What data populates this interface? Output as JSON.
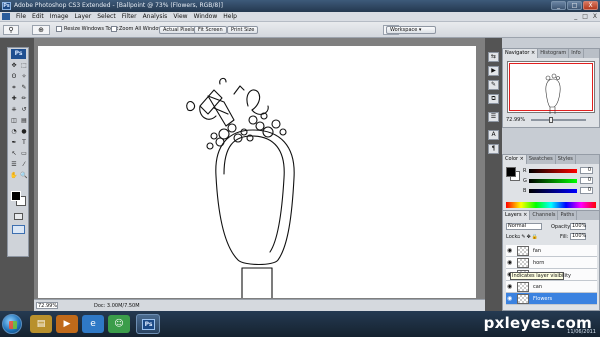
{
  "window": {
    "title": "Adobe Photoshop CS3 Extended - [Ballpoint @ 73% (Flowers, RGB/8)]",
    "app_icon_text": "Ps",
    "buttons": {
      "minimize": "_",
      "maximize": "□",
      "close": "X"
    }
  },
  "menubar": {
    "items": [
      "File",
      "Edit",
      "Image",
      "Layer",
      "Select",
      "Filter",
      "Analysis",
      "View",
      "Window",
      "Help"
    ],
    "doc_controls": [
      "_",
      "□",
      "X"
    ]
  },
  "options": {
    "resize_windows": "Resize Windows To Fit",
    "zoom_all": "Zoom All Windows",
    "actual_pixels": "Actual Pixels",
    "fit_screen": "Fit Screen",
    "print_size": "Print Size",
    "workspace": "Workspace ▾"
  },
  "tools": {
    "ps_label": "Ps",
    "icons": [
      "move-icon",
      "marquee-icon",
      "lasso-icon",
      "magic-wand-icon",
      "crop-icon",
      "slice-icon",
      "healing-icon",
      "brush-icon",
      "stamp-icon",
      "history-brush-icon",
      "eraser-icon",
      "gradient-icon",
      "blur-icon",
      "dodge-icon",
      "pen-icon",
      "type-icon",
      "path-select-icon",
      "shape-icon",
      "notes-icon",
      "eyedropper-icon",
      "hand-icon",
      "zoom-icon"
    ],
    "glyphs": [
      "✥",
      "⬚",
      "ʘ",
      "✧",
      "⌗",
      "✎",
      "✚",
      "✏",
      "⎈",
      "↺",
      "◫",
      "▤",
      "◔",
      "●",
      "✒",
      "T",
      "↖",
      "▭",
      "☰",
      "⁄",
      "✋",
      "🔍"
    ]
  },
  "status": {
    "zoom": "72.99%",
    "doc": "Doc: 3.00M/7.50M"
  },
  "navigator": {
    "tabs": [
      "Navigator ×",
      "Histogram",
      "Info"
    ],
    "zoom": "72.99%"
  },
  "color_panel": {
    "tabs": [
      "Color ×",
      "Swatches",
      "Styles"
    ],
    "channels": [
      {
        "label": "R",
        "value": "0",
        "gradient": "#000000,#ff0000"
      },
      {
        "label": "G",
        "value": "0",
        "gradient": "#000000,#00ff00"
      },
      {
        "label": "B",
        "value": "0",
        "gradient": "#000000,#0000ff"
      }
    ]
  },
  "layers_panel": {
    "tabs": [
      "Layers ×",
      "Channels",
      "Paths"
    ],
    "blend_mode": "Normal",
    "opacity_label": "Opacity:",
    "opacity": "100%",
    "lock_label": "Lock:",
    "fill_label": "Fill:",
    "fill": "100%",
    "layers": [
      {
        "name": "fan",
        "selected": false
      },
      {
        "name": "horn",
        "selected": false
      },
      {
        "name": "",
        "selected": false
      },
      {
        "name": "can",
        "selected": false
      },
      {
        "name": "Flowers",
        "selected": true
      }
    ],
    "tooltip": "Indicates layer visibility"
  },
  "taskbar": {
    "watermark": "pxleyes.com",
    "date": "11/06/2011"
  }
}
